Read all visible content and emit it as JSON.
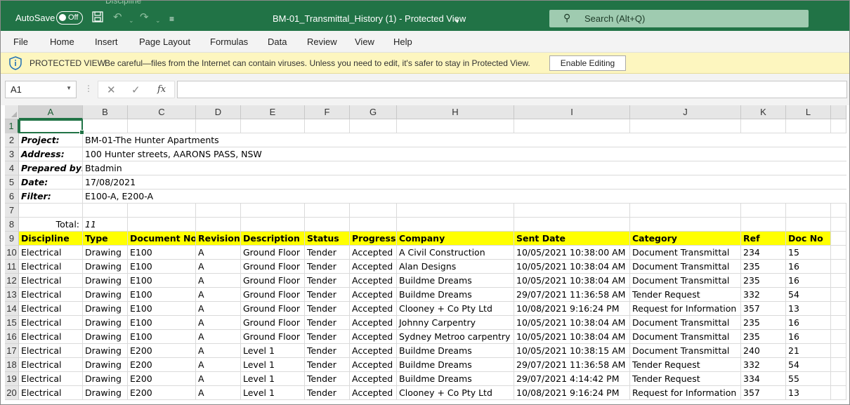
{
  "titlebar": {
    "autosave_label": "AutoSave",
    "autosave_state": "Off",
    "ghost_text": "Discipline",
    "doc_title": "BM-01_Transmittal_History (1)  -  Protected View",
    "search_placeholder": "Search (Alt+Q)",
    "icons": [
      "save-icon",
      "undo-icon",
      "redo-icon",
      "customize-icon",
      "search-icon"
    ]
  },
  "menu": [
    "File",
    "Home",
    "Insert",
    "Page Layout",
    "Formulas",
    "Data",
    "Review",
    "View",
    "Help"
  ],
  "protected_view": {
    "title": "PROTECTED VIEW",
    "message": "Be careful—files from the Internet can contain viruses. Unless you need to edit, it's safer to stay in Protected View.",
    "button": "Enable Editing"
  },
  "formula_bar": {
    "name_box": "A1",
    "fx_label": "fx",
    "value": ""
  },
  "columns": [
    "A",
    "B",
    "C",
    "D",
    "E",
    "F",
    "G",
    "H",
    "I",
    "J",
    "K",
    "L"
  ],
  "rows": [
    "1",
    "2",
    "3",
    "4",
    "5",
    "6",
    "7",
    "8",
    "9",
    "10",
    "11",
    "12",
    "13",
    "14",
    "15",
    "16",
    "17",
    "18",
    "19",
    "20"
  ],
  "info": {
    "project_label": "Project:",
    "project_value": "BM-01-The Hunter Apartments",
    "address_label": "Address:",
    "address_value": "100 Hunter streets, AARONS PASS, NSW",
    "prepared_label": "Prepared by:",
    "prepared_value": "Btadmin",
    "date_label": "Date:",
    "date_value": "17/08/2021",
    "filter_label": "Filter:",
    "filter_value": "E100-A, E200-A",
    "total_label": "Total:",
    "total_value": "11"
  },
  "table": {
    "headers": [
      "Discipline",
      "Type",
      "Document No",
      "Revision",
      "Description",
      "Status",
      "Progress",
      "Company",
      "Sent Date",
      "Category",
      "Ref",
      "Doc No"
    ],
    "rows": [
      [
        "Electrical",
        "Drawing",
        "E100",
        "A",
        "Ground Floor",
        "Tender",
        "Accepted",
        "A Civil Construction",
        "10/05/2021 10:38:00 AM",
        "Document Transmittal",
        "234",
        "15"
      ],
      [
        "Electrical",
        "Drawing",
        "E100",
        "A",
        "Ground Floor",
        "Tender",
        "Accepted",
        "Alan Designs",
        "10/05/2021 10:38:04 AM",
        "Document Transmittal",
        "235",
        "16"
      ],
      [
        "Electrical",
        "Drawing",
        "E100",
        "A",
        "Ground Floor",
        "Tender",
        "Accepted",
        "Buildme Dreams",
        "10/05/2021 10:38:04 AM",
        "Document Transmittal",
        "235",
        "16"
      ],
      [
        "Electrical",
        "Drawing",
        "E100",
        "A",
        "Ground Floor",
        "Tender",
        "Accepted",
        "Buildme Dreams",
        "29/07/2021 11:36:58 AM",
        "Tender Request",
        "332",
        "54"
      ],
      [
        "Electrical",
        "Drawing",
        "E100",
        "A",
        "Ground Floor",
        "Tender",
        "Accepted",
        "Clooney + Co Pty Ltd",
        "10/08/2021 9:16:24 PM",
        "Request for Information",
        "357",
        "13"
      ],
      [
        "Electrical",
        "Drawing",
        "E100",
        "A",
        "Ground Floor",
        "Tender",
        "Accepted",
        "Johnny Carpentry",
        "10/05/2021 10:38:04 AM",
        "Document Transmittal",
        "235",
        "16"
      ],
      [
        "Electrical",
        "Drawing",
        "E100",
        "A",
        "Ground Floor",
        "Tender",
        "Accepted",
        "Sydney Metroo carpentry",
        "10/05/2021 10:38:04 AM",
        "Document Transmittal",
        "235",
        "16"
      ],
      [
        "Electrical",
        "Drawing",
        "E200",
        "A",
        "Level 1",
        "Tender",
        "Accepted",
        "Buildme Dreams",
        "10/05/2021 10:38:15 AM",
        "Document Transmittal",
        "240",
        "21"
      ],
      [
        "Electrical",
        "Drawing",
        "E200",
        "A",
        "Level 1",
        "Tender",
        "Accepted",
        "Buildme Dreams",
        "29/07/2021 11:36:58 AM",
        "Tender Request",
        "332",
        "54"
      ],
      [
        "Electrical",
        "Drawing",
        "E200",
        "A",
        "Level 1",
        "Tender",
        "Accepted",
        "Buildme Dreams",
        "29/07/2021 4:14:42 PM",
        "Tender Request",
        "334",
        "55"
      ],
      [
        "Electrical",
        "Drawing",
        "E200",
        "A",
        "Level 1",
        "Tender",
        "Accepted",
        "Clooney + Co Pty Ltd",
        "10/08/2021 9:16:24 PM",
        "Request for Information",
        "357",
        "13"
      ]
    ]
  },
  "colors": {
    "excel_green": "#217346",
    "header_yellow": "#ffff00",
    "protected_bar": "#fdf6bf"
  }
}
